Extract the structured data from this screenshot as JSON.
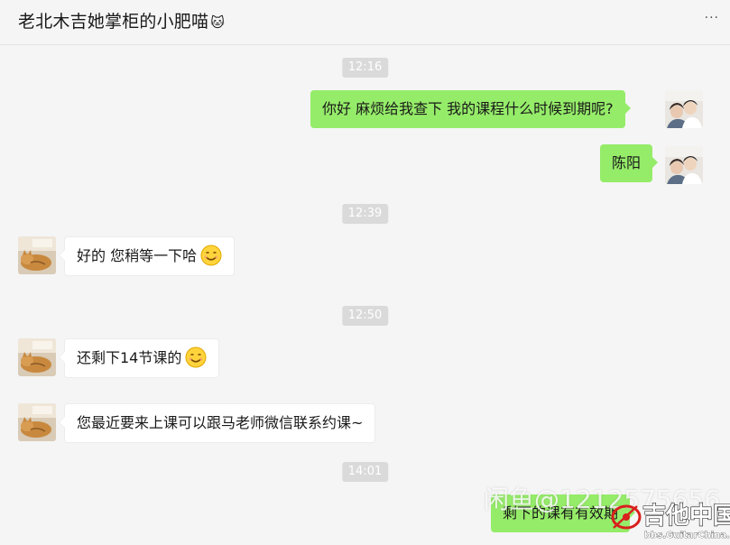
{
  "header": {
    "title": "老北木吉她掌柜的小肥喵",
    "title_emoji": "🐱",
    "more_label": "···"
  },
  "timestamps": [
    "12:16",
    "12:39",
    "12:50",
    "14:01"
  ],
  "messages": [
    {
      "direction": "outgoing",
      "text": "你好 麻烦给我查下 我的课程什么时候到期呢?"
    },
    {
      "direction": "outgoing",
      "text": "陈阳"
    },
    {
      "direction": "incoming",
      "text": "好的 您稍等一下哈",
      "emoji": "smile-emoji"
    },
    {
      "direction": "incoming",
      "text": "还剩下14节课的",
      "emoji": "smile-emoji"
    },
    {
      "direction": "incoming",
      "text": "您最近要来上课可以跟马老师微信联系约课~"
    },
    {
      "direction": "outgoing",
      "text": "剩下的课有有效期"
    }
  ],
  "watermark": {
    "text": "闲鱼@1212575656",
    "site_logo_name": "吉他中国",
    "site_url": "bbs.GuitarChina.com"
  },
  "colors": {
    "background": "#f5f5f5",
    "outgoing_bubble": "#95ec69",
    "incoming_bubble": "#ffffff",
    "time_badge": "#dadada",
    "logo_red": "#d9201c"
  }
}
